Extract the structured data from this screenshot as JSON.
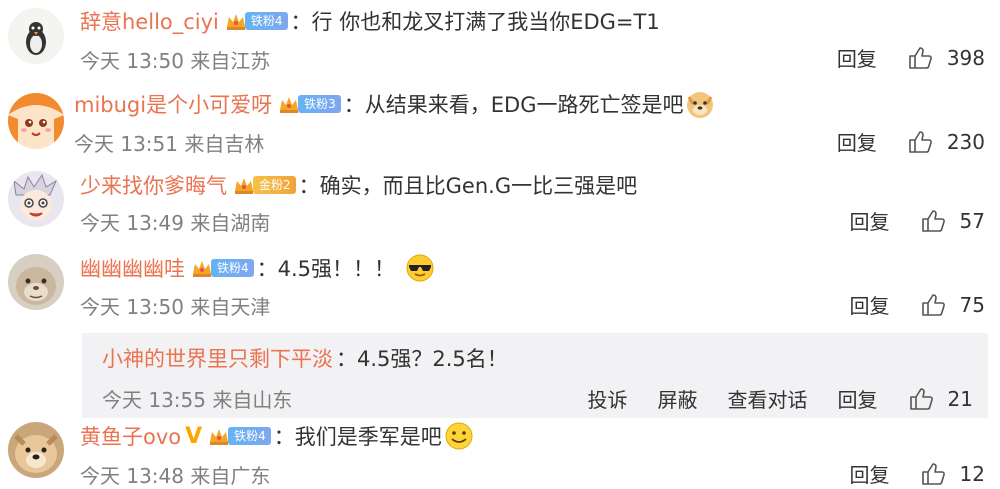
{
  "comments": [
    {
      "username": "辞意hello_ciyi",
      "badge": "铁粉4",
      "badge_type": "iron",
      "text": "行 你也和龙叉打满了我当你EDG=T1",
      "emoji": "",
      "time": "今天 13:50",
      "location": "来自江苏",
      "reply": "回复",
      "likes": "398"
    },
    {
      "username": "mibugi是个小可爱呀",
      "badge": "铁粉3",
      "badge_type": "iron",
      "text": "从结果来看，EDG一路死亡签是吧",
      "emoji": "doge-emoji",
      "time": "今天 13:51",
      "location": "来自吉林",
      "reply": "回复",
      "likes": "230"
    },
    {
      "username": "少来找你爹晦气",
      "badge": "金粉2",
      "badge_type": "gold",
      "text": "确实，而且比Gen.G一比三强是吧",
      "emoji": "",
      "time": "今天 13:49",
      "location": "来自湖南",
      "reply": "回复",
      "likes": "57"
    },
    {
      "username": "幽幽幽幽哇",
      "badge": "铁粉4",
      "badge_type": "iron",
      "text": "4.5强！！！",
      "emoji": "cool-sunglasses-emoji",
      "time": "今天 13:50",
      "location": "来自天津",
      "reply": "回复",
      "likes": "75"
    },
    {
      "username": "黄鱼子ovo",
      "badge": "铁粉4",
      "badge_type": "iron",
      "text": "我们是季军是吧",
      "emoji": "smile-emoji",
      "time": "今天 13:48",
      "location": "来自广东",
      "reply": "回复",
      "likes": "12",
      "verified": "V"
    }
  ],
  "sub_reply": {
    "username": "小神的世界里只剩下平淡",
    "text": "4.5强？2.5名！",
    "time": "今天 13:55",
    "location": "来自山东",
    "actions": [
      "投诉",
      "屏蔽",
      "查看对话",
      "回复"
    ],
    "likes": "21"
  },
  "separator": "：",
  "colors": {
    "username": "#eb7350",
    "meta": "#808080",
    "iron_badge": "#64b3f4",
    "gold_badge": "#f1a33a",
    "sub_bg": "#f2f2f5"
  }
}
